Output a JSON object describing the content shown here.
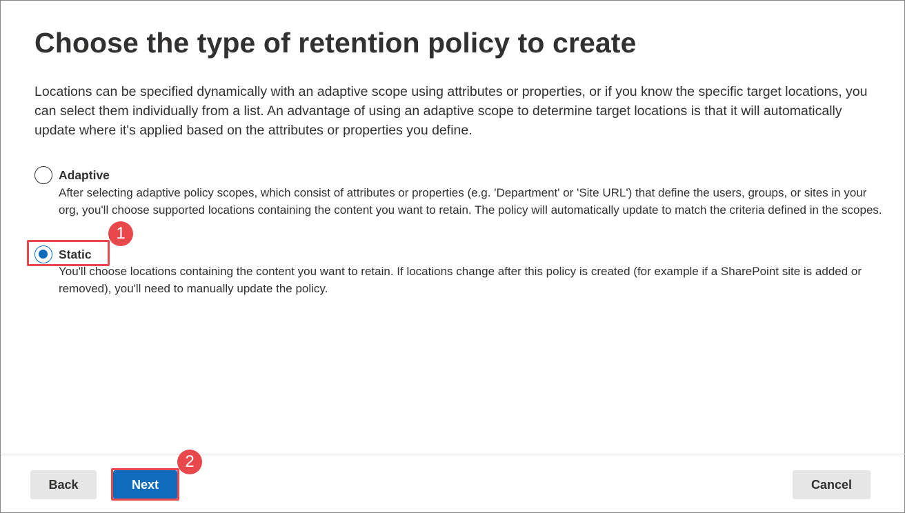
{
  "page": {
    "title": "Choose the type of retention policy to create",
    "description": "Locations can be specified dynamically with an adaptive scope using attributes or properties, or if you know the specific target locations, you can select them individually from a list. An advantage of using an adaptive scope to determine target locations is that it will automatically update where it's applied based on the attributes or properties you define."
  },
  "options": [
    {
      "label": "Adaptive",
      "description": "After selecting adaptive policy scopes, which consist of attributes or properties (e.g. 'Department' or 'Site URL') that define the users, groups, or sites in your org, you'll choose supported locations containing the content you want to retain. The policy will automatically update to match the criteria defined in the scopes.",
      "selected": false
    },
    {
      "label": "Static",
      "description": "You'll choose locations containing the content you want to retain. If locations change after this policy is created (for example if a SharePoint site is added or removed), you'll need to manually update the policy.",
      "selected": true
    }
  ],
  "annotations": {
    "step1": "1",
    "step2": "2",
    "color": "#e8474c"
  },
  "footer": {
    "back_label": "Back",
    "next_label": "Next",
    "cancel_label": "Cancel"
  },
  "colors": {
    "accent": "#0f6cbd",
    "text": "#323130",
    "secondary_button": "#e6e6e6"
  }
}
